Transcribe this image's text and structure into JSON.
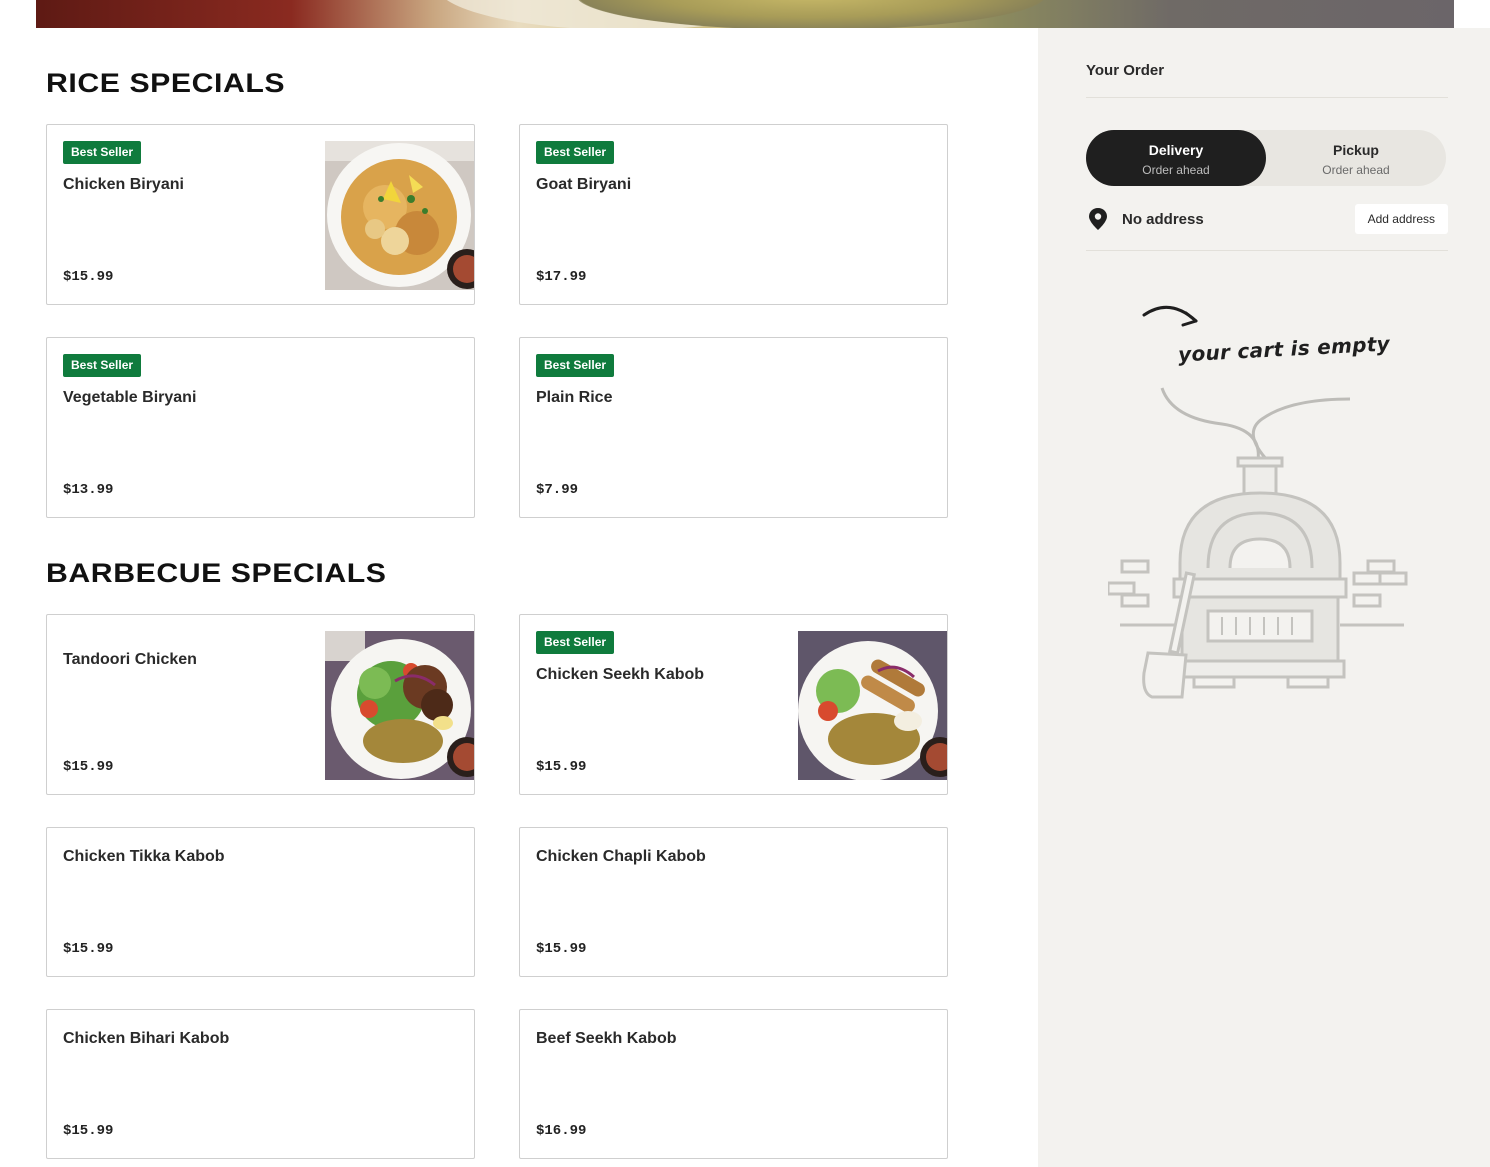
{
  "sections": [
    {
      "title": "RICE SPECIALS",
      "items": [
        {
          "badge": "Best Seller",
          "name": "Chicken Biryani",
          "price": "$15.99",
          "image": "biryani-plate"
        },
        {
          "badge": "Best Seller",
          "name": "Goat Biryani",
          "price": "$17.99"
        },
        {
          "badge": "Best Seller",
          "name": "Vegetable Biryani",
          "price": "$13.99"
        },
        {
          "badge": "Best Seller",
          "name": "Plain Rice",
          "price": "$7.99"
        }
      ]
    },
    {
      "title": "BARBECUE SPECIALS",
      "items": [
        {
          "name": "Tandoori Chicken",
          "price": "$15.99",
          "image": "tandoori-plate"
        },
        {
          "badge": "Best Seller",
          "name": "Chicken Seekh Kabob",
          "price": "$15.99",
          "image": "kabob-plate"
        },
        {
          "name": "Chicken Tikka Kabob",
          "price": "$15.99"
        },
        {
          "name": "Chicken Chapli Kabob",
          "price": "$15.99"
        },
        {
          "name": "Chicken Bihari Kabob",
          "price": "$15.99"
        },
        {
          "name": "Beef Seekh Kabob",
          "price": "$16.99"
        }
      ]
    }
  ],
  "sidebar": {
    "title": "Your Order",
    "delivery": {
      "label": "Delivery",
      "sub": "Order ahead"
    },
    "pickup": {
      "label": "Pickup",
      "sub": "Order ahead"
    },
    "address": {
      "text": "No address",
      "button": "Add address",
      "icon": "map-pin-icon"
    },
    "empty_cart": {
      "text": "your cart is empty",
      "illustration": "oven-illustration"
    }
  },
  "colors": {
    "badge": "#0f7b3d",
    "sidebar_bg": "#f3f2ef",
    "toggle_active": "#1f1f1f"
  }
}
